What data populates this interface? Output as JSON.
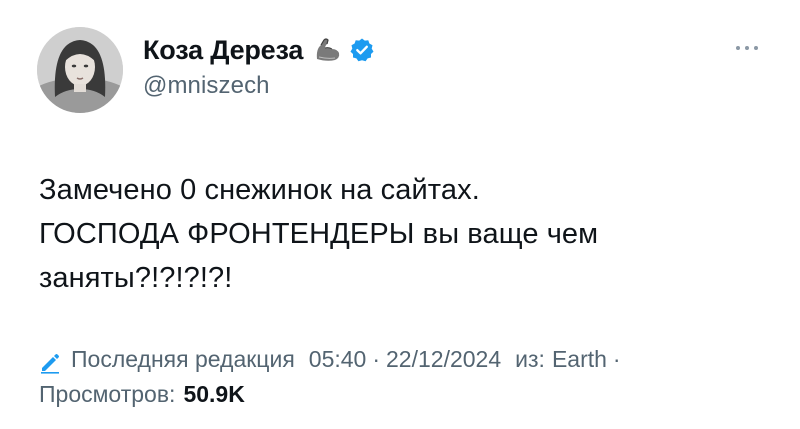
{
  "author": {
    "display_name": "Коза Дереза",
    "handle": "@mniszech",
    "badge_emoji": "muscle-emoji",
    "verified": true
  },
  "post": {
    "lines": [
      "Замечено 0 снежинок на сайтах.",
      "ГОСПОДА ФРОНТЕНДЕРЫ вы ваще чем",
      "заняты?!?!?!?!"
    ]
  },
  "meta": {
    "edited_label": "Последняя редакция",
    "time": "05:40",
    "separator": "·",
    "date": "22/12/2024",
    "source_prefix": "из:",
    "source": "Earth",
    "trailing_separator": "·",
    "views_label": "Просмотров:",
    "views_count": "50.9K"
  },
  "colors": {
    "text_primary": "#0f1419",
    "text_secondary": "#536471",
    "verified_blue": "#1d9bf0",
    "edit_blue": "#1d9bf0"
  }
}
